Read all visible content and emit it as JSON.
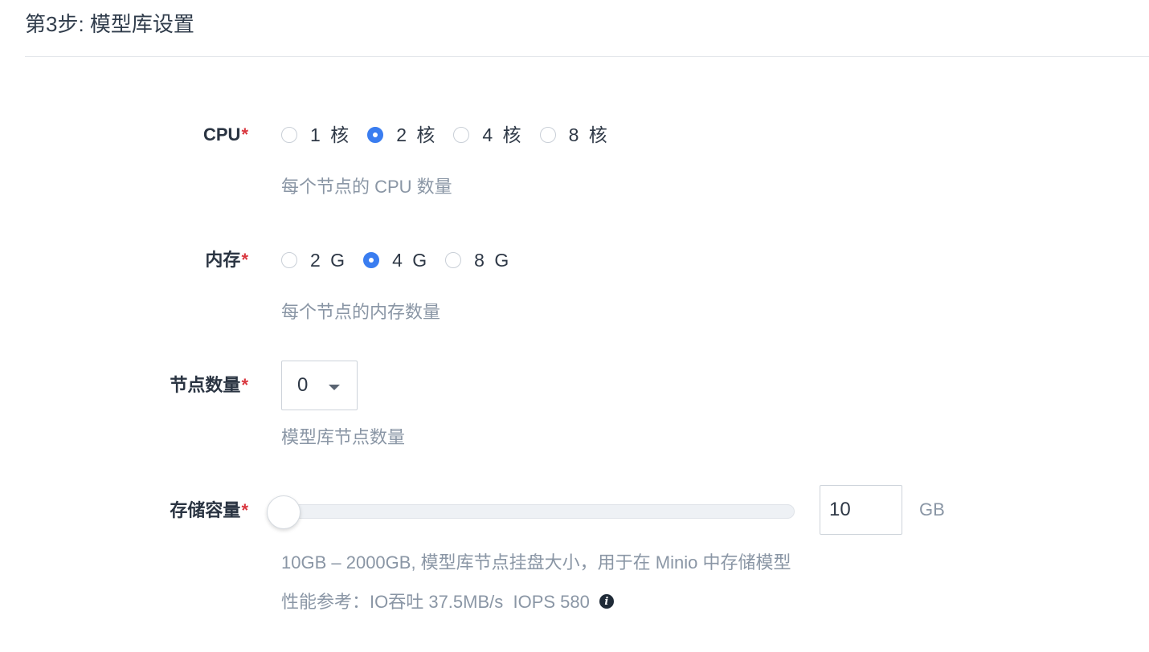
{
  "step_title": "第3步: 模型库设置",
  "required_mark": "*",
  "cpu": {
    "label": "CPU",
    "options": [
      "1 核",
      "2 核",
      "4 核",
      "8 核"
    ],
    "selected": "2 核",
    "hint": "每个节点的 CPU 数量"
  },
  "memory": {
    "label": "内存",
    "options": [
      "2 G",
      "4 G",
      "8 G"
    ],
    "selected": "4 G",
    "hint": "每个节点的内存数量"
  },
  "nodes": {
    "label": "节点数量",
    "value": "0",
    "hint": "模型库节点数量"
  },
  "storage": {
    "label": "存储容量",
    "value": "10",
    "slider_min": 10,
    "slider_max": 2000,
    "unit": "GB",
    "hint": "10GB – 2000GB, 模型库节点挂盘大小，用于在 Minio 中存储模型",
    "perf": "性能参考：IO吞吐 37.5MB/s  IOPS 580"
  }
}
